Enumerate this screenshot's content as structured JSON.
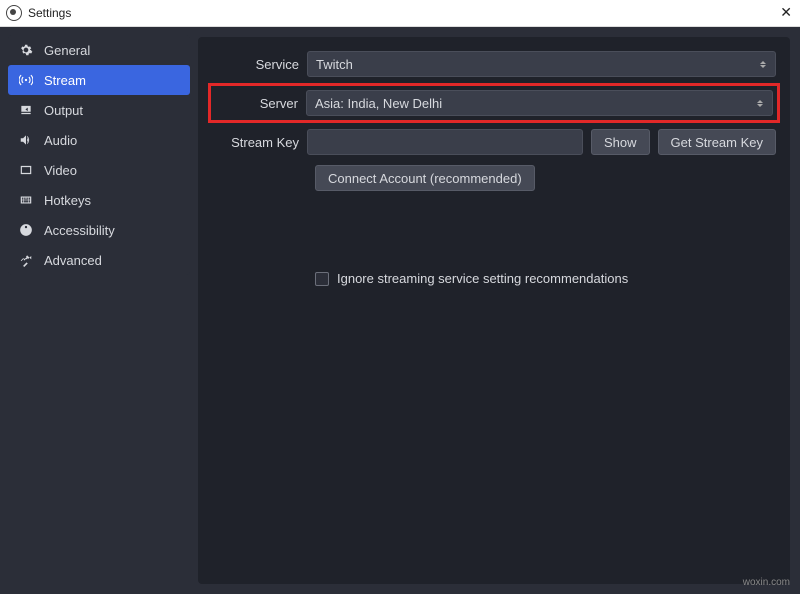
{
  "titlebar": {
    "title": "Settings"
  },
  "sidebar": {
    "items": [
      {
        "label": "General"
      },
      {
        "label": "Stream"
      },
      {
        "label": "Output"
      },
      {
        "label": "Audio"
      },
      {
        "label": "Video"
      },
      {
        "label": "Hotkeys"
      },
      {
        "label": "Accessibility"
      },
      {
        "label": "Advanced"
      }
    ]
  },
  "form": {
    "service_label": "Service",
    "service_value": "Twitch",
    "server_label": "Server",
    "server_value": "Asia: India, New Delhi",
    "streamkey_label": "Stream Key",
    "show_button": "Show",
    "getkey_button": "Get Stream Key",
    "connect_button": "Connect Account (recommended)",
    "ignore_checkbox": "Ignore streaming service setting recommendations"
  },
  "watermark": "woxin.com"
}
